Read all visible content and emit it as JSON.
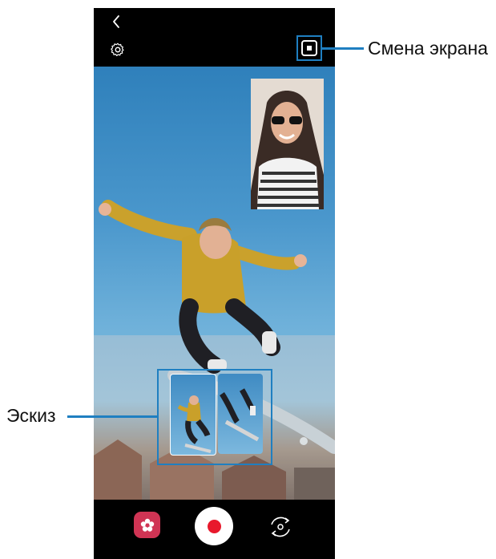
{
  "annotations": {
    "screen_switch_label": "Смена экрана",
    "thumbnail_label": "Эскиз"
  },
  "icons": {
    "back": "chevron-left-icon",
    "settings": "gear-icon",
    "screen_switch": "screen-switch-icon",
    "effects": "flower-icon",
    "record": "record-icon",
    "flip": "camera-flip-icon"
  },
  "colors": {
    "callout": "#1f7fc1",
    "record_dot": "#e8192c",
    "effects_button": "#d03454"
  }
}
